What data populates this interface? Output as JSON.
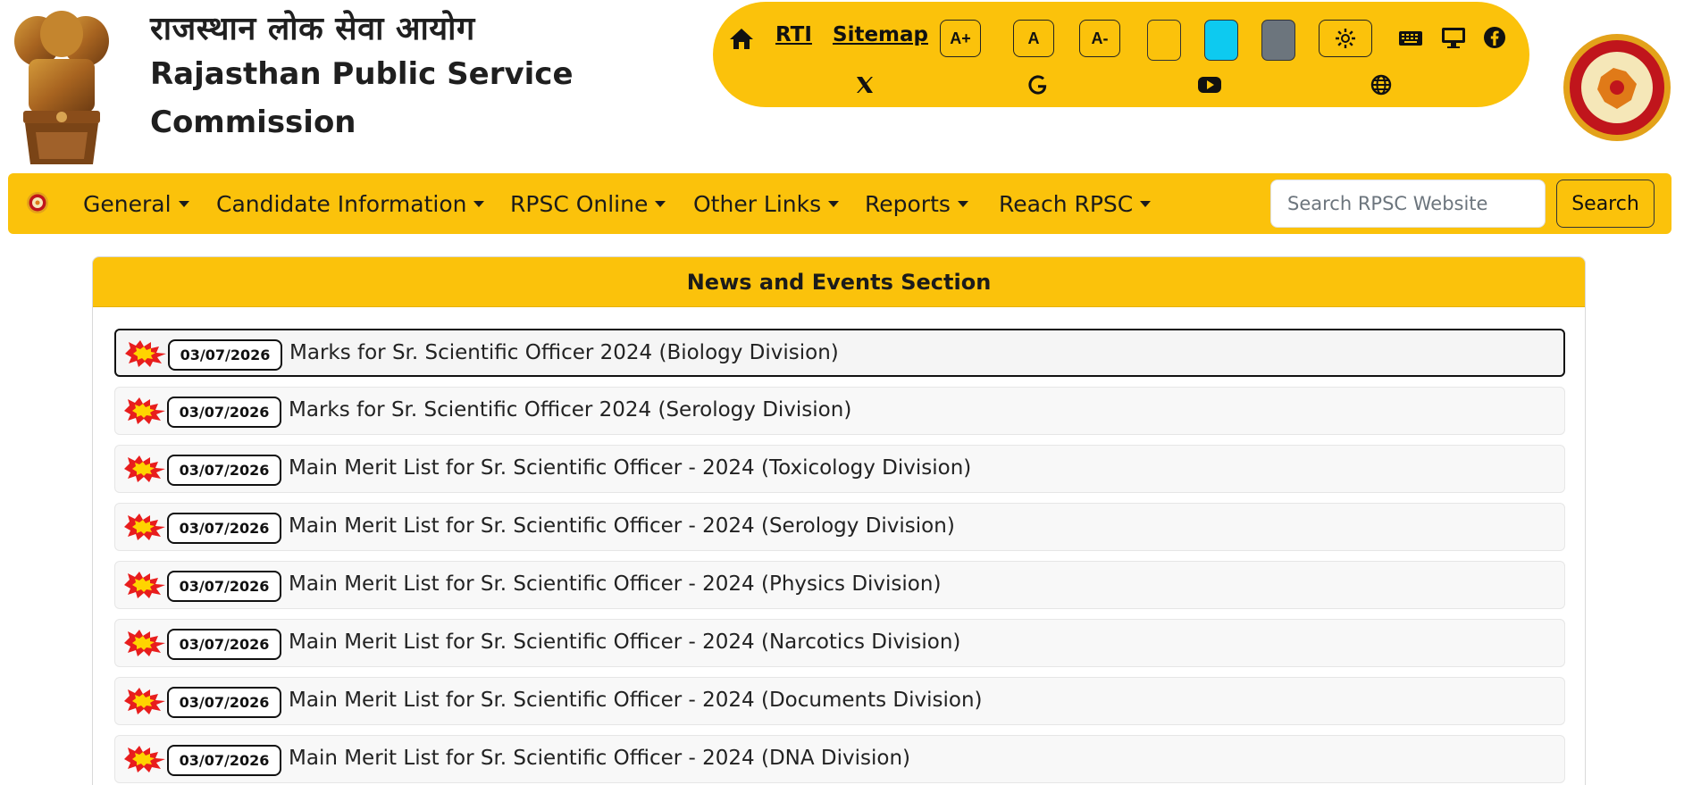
{
  "header": {
    "title_hindi": "राजस्थान लोक सेवा आयोग",
    "title_en_line1": "Rajasthan Public Service",
    "title_en_line2": "Commission"
  },
  "utility": {
    "rti": "RTI",
    "sitemap": "Sitemap",
    "font_increase": "A+",
    "font_normal": "A",
    "font_decrease": "A-",
    "themes": [
      "#fbc20b",
      "#0dcaf0",
      "#6c757d"
    ]
  },
  "nav": {
    "items": [
      {
        "label": "General"
      },
      {
        "label": "Candidate Information"
      },
      {
        "label": "RPSC Online"
      },
      {
        "label": "Other Links"
      },
      {
        "label": "Reports"
      },
      {
        "label": "Reach RPSC"
      }
    ],
    "search_placeholder": "Search RPSC Website",
    "search_button": "Search"
  },
  "news": {
    "heading": "News and Events Section",
    "items": [
      {
        "date": "03/07/2026",
        "title": "Marks for Sr. Scientific Officer 2024 (Biology Division)"
      },
      {
        "date": "03/07/2026",
        "title": "Marks for Sr. Scientific Officer 2024 (Serology Division)"
      },
      {
        "date": "03/07/2026",
        "title": "Main Merit List for Sr. Scientific Officer - 2024 (Toxicology Division)"
      },
      {
        "date": "03/07/2026",
        "title": "Main Merit List for Sr. Scientific Officer - 2024 (Serology Division)"
      },
      {
        "date": "03/07/2026",
        "title": "Main Merit List for Sr. Scientific Officer - 2024 (Physics Division)"
      },
      {
        "date": "03/07/2026",
        "title": "Main Merit List for Sr. Scientific Officer - 2024 (Narcotics Division)"
      },
      {
        "date": "03/07/2026",
        "title": "Main Merit List for Sr. Scientific Officer - 2024 (Documents Division)"
      },
      {
        "date": "03/07/2026",
        "title": "Main Merit List for Sr. Scientific Officer - 2024 (DNA Division)"
      }
    ]
  }
}
